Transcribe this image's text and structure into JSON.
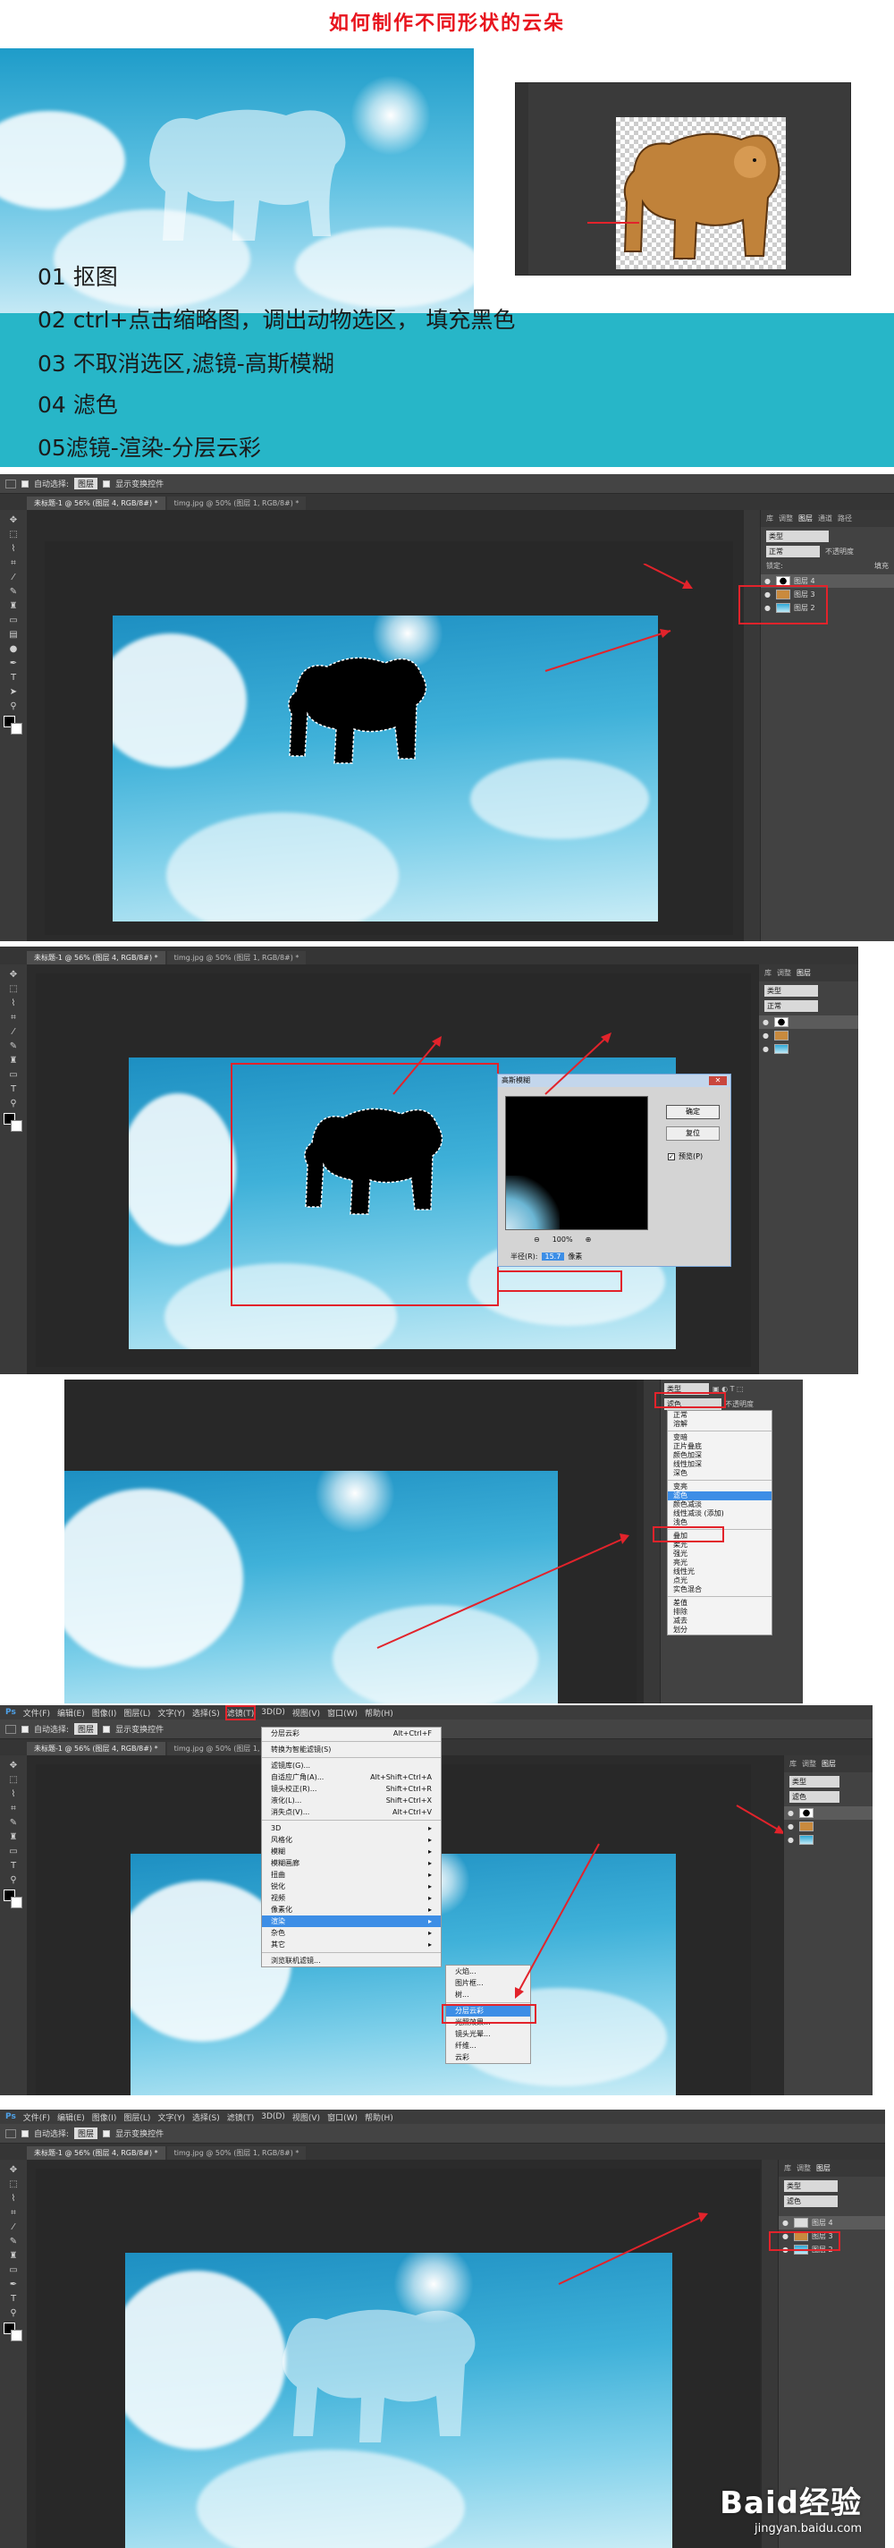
{
  "title": "如何制作不同形状的云朵",
  "steps": [
    "01           抠图",
    "02  ctrl+点击缩略图，调出动物选区， 填充黑色",
    "03 不取消选区,滤镜-高斯模糊",
    "04 滤色",
    "05滤镜-渲染-分层云彩"
  ],
  "ps": {
    "options": {
      "auto_select": "自动选择:",
      "layer_select": "图层",
      "show_transform": "显示变换控件"
    },
    "tabs": {
      "doc1": "未标题-1 @ 56% (图层 4, RGB/8#) *",
      "doc2": "timg.jpg @ 50% (图层 1, RGB/8#) *"
    },
    "panel_tabs": [
      "库",
      "调整",
      "图层",
      "通道",
      "路径"
    ],
    "panel_tabs_short": [
      "库",
      "调整",
      "图层"
    ],
    "kind_select": "类型",
    "blend_normal": "正常",
    "blend_screen": "滤色",
    "opacity_label": "不透明度",
    "lock_label": "锁定:",
    "fill_label": "填充",
    "layers": [
      "图层 4",
      "图层 3",
      "图层 2"
    ],
    "gaussian": {
      "title": "高斯模糊",
      "ok": "确定",
      "reset": "复位",
      "preview": "预览(P)",
      "zoom": "100%",
      "radius_label": "半径(R):",
      "radius_value": "15.7",
      "unit": "像素"
    },
    "blend_modes": [
      "正常",
      "溶解",
      "变暗",
      "正片叠底",
      "颜色加深",
      "线性加深",
      "深色",
      "变亮",
      "滤色",
      "颜色减淡",
      "线性减淡 (添加)",
      "浅色",
      "叠加",
      "柔光",
      "强光",
      "亮光",
      "线性光",
      "点光",
      "实色混合",
      "差值",
      "排除",
      "减去",
      "划分"
    ],
    "menubar": [
      "文件(F)",
      "编辑(E)",
      "图像(I)",
      "图层(L)",
      "文字(Y)",
      "选择(S)",
      "滤镜(T)",
      "3D(D)",
      "视图(V)",
      "窗口(W)",
      "帮助(H)"
    ],
    "filter_menu": {
      "last": {
        "label": "分层云彩",
        "shortcut": "Alt+Ctrl+F"
      },
      "smart": "转换为智能滤镜(S)",
      "gallery": "滤镜库(G)...",
      "items_short": [
        {
          "label": "自适应广角(A)...",
          "shortcut": "Alt+Shift+Ctrl+A"
        },
        {
          "label": "镜头校正(R)...",
          "shortcut": "Shift+Ctrl+R"
        },
        {
          "label": "液化(L)...",
          "shortcut": "Shift+Ctrl+X"
        },
        {
          "label": "消失点(V)...",
          "shortcut": "Alt+Ctrl+V"
        }
      ],
      "groups": [
        "3D",
        "风格化",
        "模糊",
        "模糊画廊",
        "扭曲",
        "锐化",
        "视频",
        "像素化",
        "渲染",
        "杂色",
        "其它"
      ],
      "browse": "浏览联机滤镜..."
    },
    "render_submenu": [
      "火焰...",
      "图片框...",
      "树...",
      "分层云彩",
      "光照效果...",
      "镜头光晕...",
      "纤维...",
      "云彩"
    ]
  },
  "watermark": {
    "logo": "Baid经验",
    "url": "jingyan.baidu.com"
  },
  "colors": {
    "accent_red": "#e2232b",
    "band": "#27b6c8",
    "title_red": "#e8141e"
  }
}
